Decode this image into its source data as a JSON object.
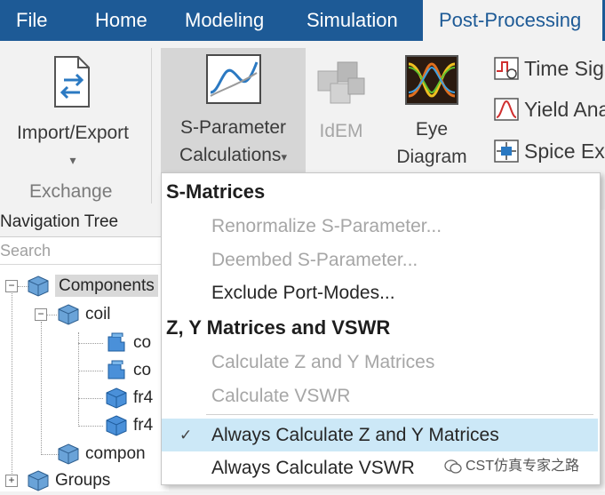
{
  "menu": {
    "tabs": [
      {
        "label": "File"
      },
      {
        "label": "Home"
      },
      {
        "label": "Modeling"
      },
      {
        "label": "Simulation"
      },
      {
        "label": "Post-Processing"
      }
    ],
    "active_tab": "Post-Processing"
  },
  "ribbon": {
    "import_export": {
      "label": "Import/Export",
      "arrow": "▾"
    },
    "exchange_group": "Exchange",
    "sparam": {
      "line1": "S-Parameter",
      "line2": "Calculations",
      "arrow": "▾"
    },
    "idem": {
      "label": "IdEM"
    },
    "eye": {
      "line1": "Eye",
      "line2": "Diagram"
    },
    "small_cmds": [
      {
        "label": "Time Sig",
        "icon": "time-signal-icon"
      },
      {
        "label": "Yield Ana",
        "icon": "yield-analysis-icon"
      },
      {
        "label": "Spice Ext",
        "icon": "spice-extraction-icon"
      }
    ]
  },
  "nav": {
    "title": "Navigation Tree",
    "search_placeholder": "Search",
    "items": [
      {
        "label": "Components"
      },
      {
        "label": "coil"
      },
      {
        "label": "co"
      },
      {
        "label": "co"
      },
      {
        "label": "fr4"
      },
      {
        "label": "fr4"
      },
      {
        "label": "compon"
      },
      {
        "label": "Groups"
      }
    ]
  },
  "dropdown": {
    "sections": [
      {
        "header": "S-Matrices",
        "items": [
          {
            "label": "Renormalize S-Parameter...",
            "enabled": false
          },
          {
            "label": "Deembed S-Parameter...",
            "enabled": false
          },
          {
            "label": "Exclude Port-Modes...",
            "enabled": true
          }
        ]
      },
      {
        "header": "Z, Y Matrices and VSWR",
        "items": [
          {
            "label": "Calculate Z and Y Matrices",
            "enabled": false
          },
          {
            "label": "Calculate VSWR",
            "enabled": false
          },
          {
            "label": "Always Calculate Z and Y Matrices",
            "enabled": true,
            "checked": true,
            "check": "✓"
          },
          {
            "label": "Always Calculate VSWR",
            "enabled": true,
            "checked": false
          }
        ]
      }
    ]
  },
  "watermark": "CST仿真专家之路",
  "colors": {
    "menubar": "#1d5a96",
    "checked_bg": "#cce8f7",
    "disabled_text": "#a6a6a6"
  }
}
